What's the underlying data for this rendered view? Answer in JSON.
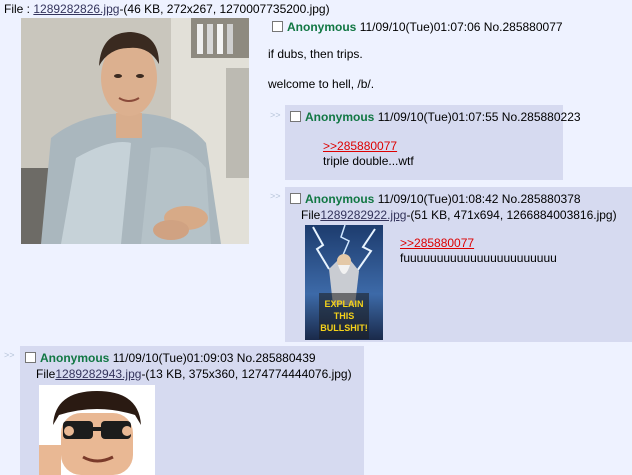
{
  "op": {
    "file_label": "File : ",
    "file_name": "1289282826.jpg",
    "file_meta": "-(46 KB, 272x267, 1270007735200.jpg)",
    "name": "Anonymous",
    "datetime": "11/09/10(Tue)01:07:06",
    "post_no": "No.285880077",
    "message_lines": [
      "if dubs, then trips.",
      "welcome to hell, /b/."
    ]
  },
  "replies": [
    {
      "arrows": ">>",
      "name": "Anonymous",
      "datetime": "11/09/10(Tue)01:07:55",
      "post_no": "No.285880223",
      "quote": ">>285880077",
      "message": "triple double...wtf"
    },
    {
      "arrows": ">>",
      "name": "Anonymous",
      "datetime": "11/09/10(Tue)01:08:42",
      "post_no": "No.285880378",
      "file_label": "File",
      "file_name": "1289282922.jpg",
      "file_meta": "-(51 KB, 471x694, 1266884003816.jpg)",
      "image_caption_lines": [
        "EXPLAIN",
        "THIS",
        "BULLSHIT!"
      ],
      "quote": ">>285880077",
      "message": "fuuuuuuuuuuuuuuuuuuuuuuu"
    },
    {
      "arrows": ">>",
      "name": "Anonymous",
      "datetime": "11/09/10(Tue)01:09:03",
      "post_no": "No.285880439",
      "file_label": "File",
      "file_name": "1289282943.jpg",
      "file_meta": "-(13 KB, 375x360, 1274774444076.jpg)"
    }
  ]
}
